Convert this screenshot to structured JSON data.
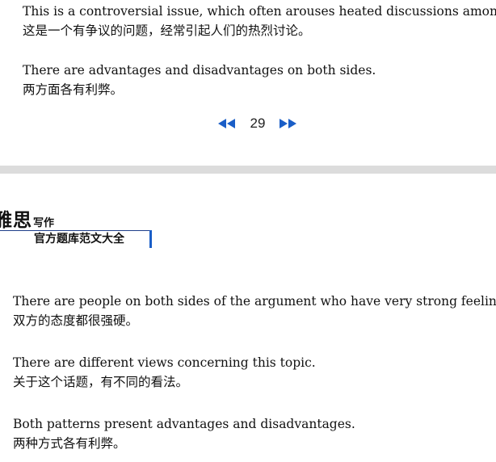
{
  "top_page": {
    "p1_en": "This is a controversial issue, which often arouses heated discussions among people.",
    "p1_zh": "这是一个有争议的问题，经常引起人们的热烈讨论。",
    "p2_en": "There are advantages and disadvantages on both sides.",
    "p2_zh": "两方面各有利弊。"
  },
  "pager": {
    "page_number": "29",
    "prev_icon": "double-left-arrow-icon",
    "next_icon": "double-right-arrow-icon",
    "icon_color": "#1a5ec7"
  },
  "brand": {
    "title_big": "雅思",
    "title_small": "写作",
    "subtitle": "官方题库范文大全",
    "accent_color": "#1a5ec7"
  },
  "bottom_page": {
    "p1_en": "There are people on both sides of the argument who have very strong feelings.",
    "p1_zh": "双方的态度都很强硬。",
    "p2_en": "There are different views concerning this topic.",
    "p2_zh": "关于这个话题，有不同的看法。",
    "p3_en": "Both patterns present advantages and disadvantages.",
    "p3_zh": "两种方式各有利弊。"
  }
}
